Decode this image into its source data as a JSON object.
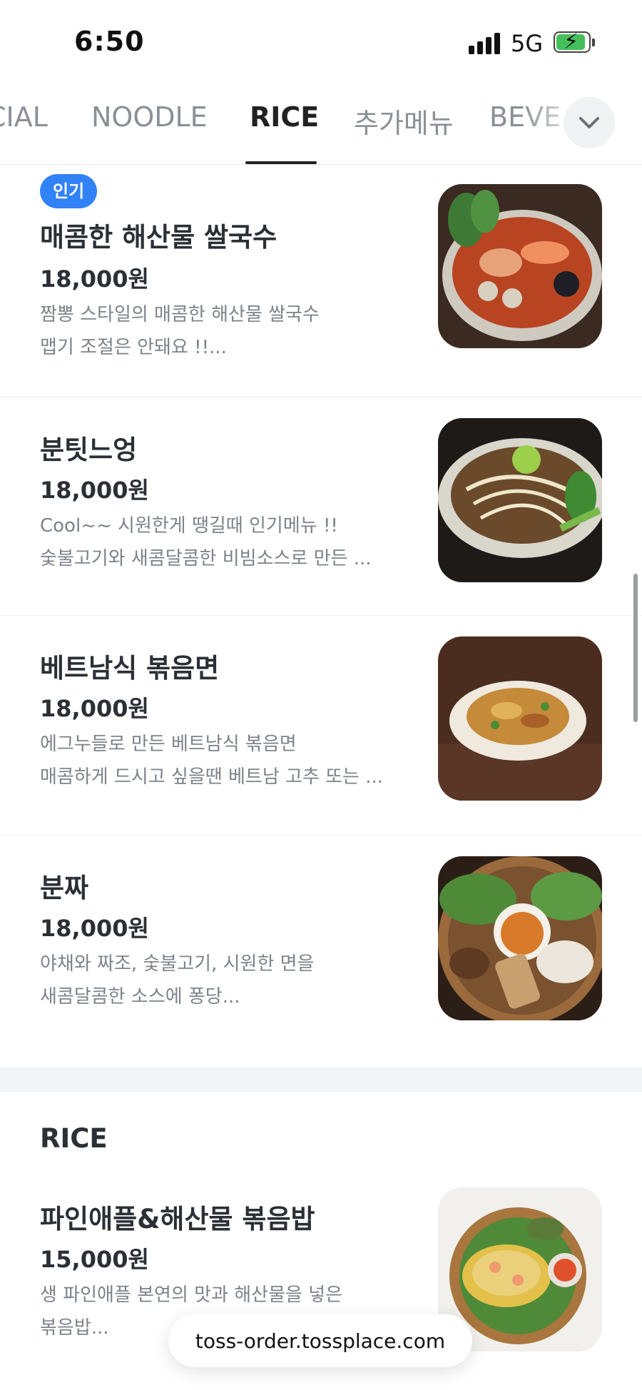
{
  "status_bar": {
    "time": "6:50",
    "network": "5G",
    "battery_charging": true
  },
  "tabs": [
    {
      "label": "CIAL",
      "active": false
    },
    {
      "label": "NOODLE",
      "active": false
    },
    {
      "label": "RICE",
      "active": true
    },
    {
      "label": "추가메뉴",
      "active": false
    },
    {
      "label": "BEVE",
      "active": false
    }
  ],
  "tab_more_icon": "chevron-down-icon",
  "menu_items": [
    {
      "badge": "인기",
      "name": "매콤한 해산물 쌀국수",
      "price": "18,000원",
      "desc_line1": "짬뽕 스타일의 매콤한 해산물 쌀국수",
      "desc_line2": "맵기 조절은 안돼요 !!..."
    },
    {
      "name": "분팃느엉",
      "price": "18,000원",
      "desc_line1": "Cool~~ 시원한게 땡길때 인기메뉴 !!",
      "desc_line2": "숯불고기와 새콤달콤한 비빔소스로 만든 ..."
    },
    {
      "name": "베트남식 볶음면",
      "price": "18,000원",
      "desc_line1": "에그누들로 만든 베트남식 볶음면",
      "desc_line2": "매콤하게 드시고 싶을땐 베트남 고추 또는 ..."
    },
    {
      "name": "분짜",
      "price": "18,000원",
      "desc_line1": "야채와 짜조, 숯불고기, 시원한 면을",
      "desc_line2": "새콤달콤한 소스에 퐁당..."
    }
  ],
  "section": {
    "title": "RICE",
    "items": [
      {
        "name": "파인애플&해산물 볶음밥",
        "price": "15,000원",
        "desc_line1": "생 파인애플 본연의 맛과 해산물을 넣은",
        "desc_line2": "볶음밥..."
      }
    ]
  },
  "url_bar": {
    "url": "toss-order.tossplace.com"
  },
  "colors": {
    "accent": "#3182f6",
    "text_primary": "#2b2f36",
    "text_secondary": "#7d828a",
    "section_gap": "#f2f4f6"
  }
}
